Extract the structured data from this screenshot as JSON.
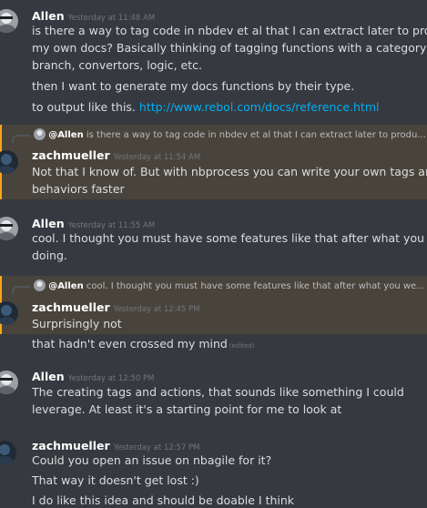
{
  "messages": [
    {
      "username": "Allen",
      "timestamp": "Yesterday at 11:48 AM",
      "lines": [
        "is there a way to tag code in nbdev et al that I can extract later to produce",
        "my own docs? Basically thinking of tagging functions with  a category ie",
        "branch, convertors, logic, etc.",
        "then I want to generate my docs functions by their type."
      ],
      "link_prefix": "to output like this. ",
      "link_text": "http://www.rebol.com/docs/reference.html"
    },
    {
      "reply": {
        "name": "@Allen",
        "text": "is there a way to tag code in nbdev et al that I can extract later to produ..."
      },
      "username": "zachmueller",
      "timestamp": "Yesterday at 11:54 AM",
      "lines": [
        "Not that I know of. But with nbprocess you can write your own tags and",
        "behaviors faster"
      ]
    },
    {
      "username": "Allen",
      "timestamp": "Yesterday at 11:55 AM",
      "lines": [
        "cool. I thought you must have some features like that after what you were",
        "doing."
      ]
    },
    {
      "reply": {
        "name": "@Allen",
        "text": "cool. I thought you must have some features like that after what you we..."
      },
      "username": "zachmueller",
      "timestamp": "Yesterday at 12:45 PM",
      "lines": [
        "Surprisingly not"
      ],
      "followup": "that hadn't even crossed my mind",
      "edited": "(edited)"
    },
    {
      "username": "Allen",
      "timestamp": "Yesterday at 12:50 PM",
      "lines": [
        "The creating tags and actions, that sounds like something I could",
        "leverage. At least it's a starting point for me to look at"
      ]
    },
    {
      "username": "zachmueller",
      "timestamp": "Yesterday at 12:57 PM",
      "lines": [
        "Could you open an issue on nbagile for it?",
        "That way it doesn't get lost :)",
        "I do like this idea and should be doable I think"
      ]
    }
  ],
  "colors": {
    "background": "#36393f",
    "mention_highlight": "#faa61a",
    "link": "#00b0f4",
    "username": "#ffffff",
    "text": "#dcddde",
    "timestamp": "#72767d"
  }
}
